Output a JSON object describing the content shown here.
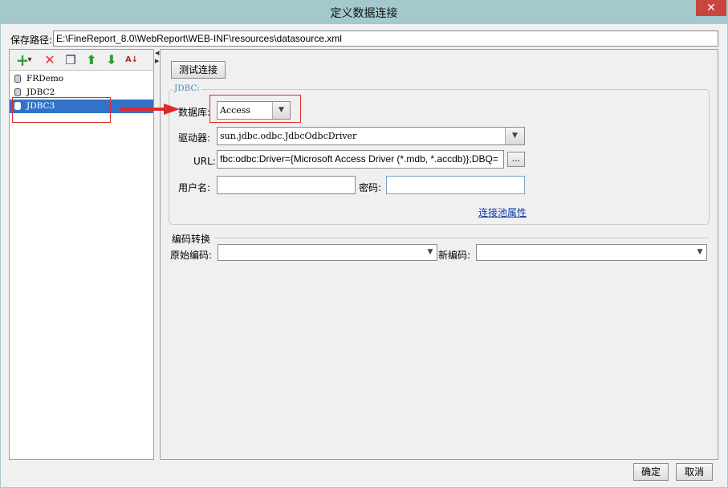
{
  "window": {
    "title": "定义数据连接",
    "close_label": "✕"
  },
  "save_path": {
    "label": "保存路径:",
    "value": "E:\\FineReport_8.0\\WebReport\\WEB-INF\\resources\\datasource.xml"
  },
  "toolbar": {
    "add_icon": "+",
    "add_dropdown": "▾",
    "delete_icon": "✕",
    "copy_icon": "❐",
    "up_icon": "⬆",
    "down_icon": "⬇",
    "sort_icon": "A↓"
  },
  "connections": [
    {
      "name": "FRDemo",
      "selected": false
    },
    {
      "name": "JDBC2",
      "selected": false
    },
    {
      "name": "JDBC3",
      "selected": true
    }
  ],
  "test_button": "测试连接",
  "jdbc": {
    "legend": "JDBC:",
    "db_label": "数据库:",
    "db_value": "Access",
    "driver_label": "驱动器:",
    "driver_value": "sun.jdbc.odbc.JdbcOdbcDriver",
    "url_label": "URL:",
    "url_value": "fbc:odbc:Driver={Microsoft Access Driver (*.mdb, *.accdb)};DBQ=",
    "url_more": "...",
    "user_label": "用户名:",
    "user_value": "",
    "password_label": "密码:",
    "password_value": "",
    "pool_link": "连接池属性"
  },
  "encoding": {
    "legend": "编码转换",
    "orig_label": "原始编码:",
    "orig_value": "",
    "new_label": "新编码:",
    "new_value": ""
  },
  "footer": {
    "ok": "确定",
    "cancel": "取消"
  },
  "colors": {
    "titlebar": "#a3c9cd",
    "close": "#c7463d",
    "selection": "#3273c9",
    "annotation": "#e02a2a",
    "link": "#0a3fa7"
  }
}
